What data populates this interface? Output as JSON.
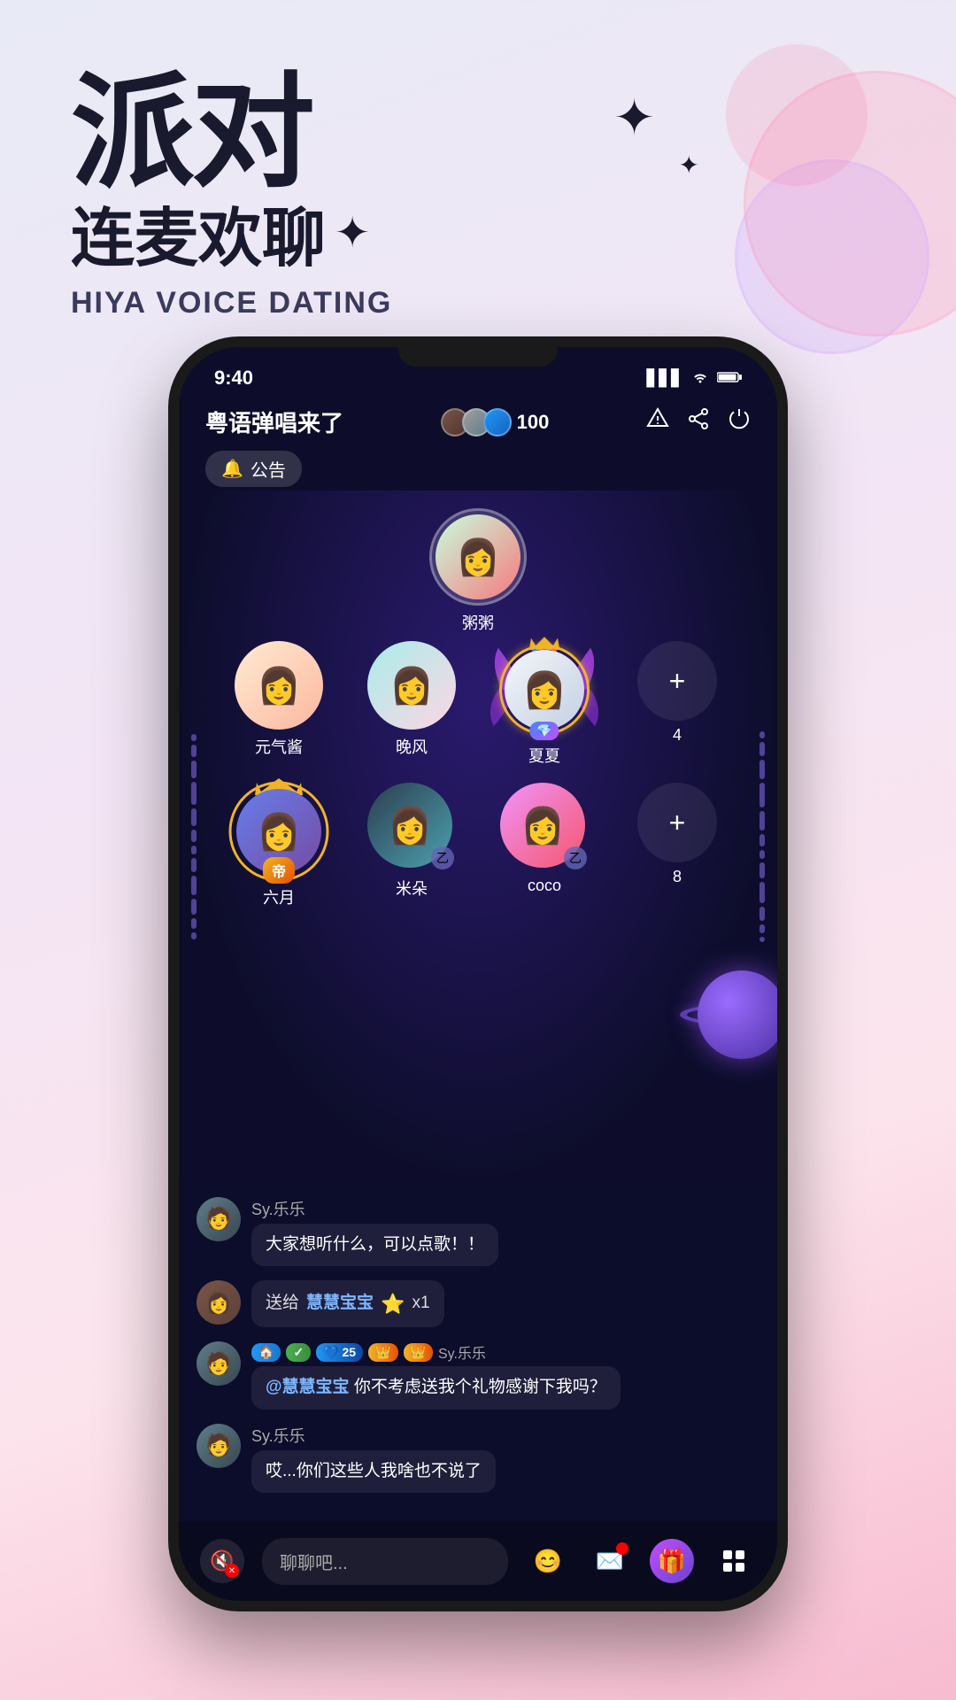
{
  "app": {
    "title": "派对 连麦欢聊",
    "title_cn_big": "派对",
    "title_cn_sub": "连麦欢聊",
    "title_en": "HIYA VOICE DATING"
  },
  "status_bar": {
    "time": "9:40",
    "signal": "▋▋▋",
    "wifi": "wifi",
    "battery": "battery"
  },
  "room": {
    "title": "粤语弹唱来了",
    "notice_label": "公告",
    "viewer_count": "100"
  },
  "host": {
    "name": "粥粥",
    "avatar_emoji": "👩"
  },
  "seats_row1": [
    {
      "name": "元气酱",
      "type": "normal",
      "emoji": "👩"
    },
    {
      "name": "晚风",
      "type": "normal",
      "emoji": "👩"
    },
    {
      "name": "夏夏",
      "type": "special_purple",
      "emoji": "👩"
    }
  ],
  "seats_row1_extra": {
    "add_label": "+",
    "count": "4"
  },
  "seats_row2": [
    {
      "name": "六月",
      "type": "special_gold",
      "emoji": "👩"
    },
    {
      "name": "米朵",
      "type": "normal_badge",
      "emoji": "👩"
    },
    {
      "name": "coco",
      "type": "normal_badge",
      "emoji": "👩"
    }
  ],
  "seats_row2_extra": {
    "add_label": "+",
    "count": "8"
  },
  "chat_messages": [
    {
      "username": "Sy.乐乐",
      "avatar_emoji": "🧑",
      "text": "大家想听什么，可以点歌！！",
      "type": "normal"
    },
    {
      "username": "",
      "avatar_emoji": "👩",
      "send_text": "送给",
      "target": "慧慧宝宝",
      "gift": "⭐",
      "gift_count": "x1",
      "type": "gift"
    },
    {
      "username": "Sy.乐乐",
      "avatar_emoji": "🧑",
      "badges": [
        "🏠",
        "✓",
        "25",
        "👑",
        "Sy.乐乐"
      ],
      "mention": "@慧慧宝宝",
      "text": " 你不考虑送我个礼物感谢下我吗？",
      "type": "mention"
    },
    {
      "username": "Sy.乐乐",
      "avatar_emoji": "🧑",
      "text": "哎...你们这些人我啥也不说了",
      "type": "normal"
    }
  ],
  "bottom_bar": {
    "mute_label": "🔇",
    "chat_placeholder": "聊聊吧...",
    "emoji_label": "😊",
    "mail_label": "✉",
    "gift_label": "🎁",
    "menu_label": "⊞"
  }
}
